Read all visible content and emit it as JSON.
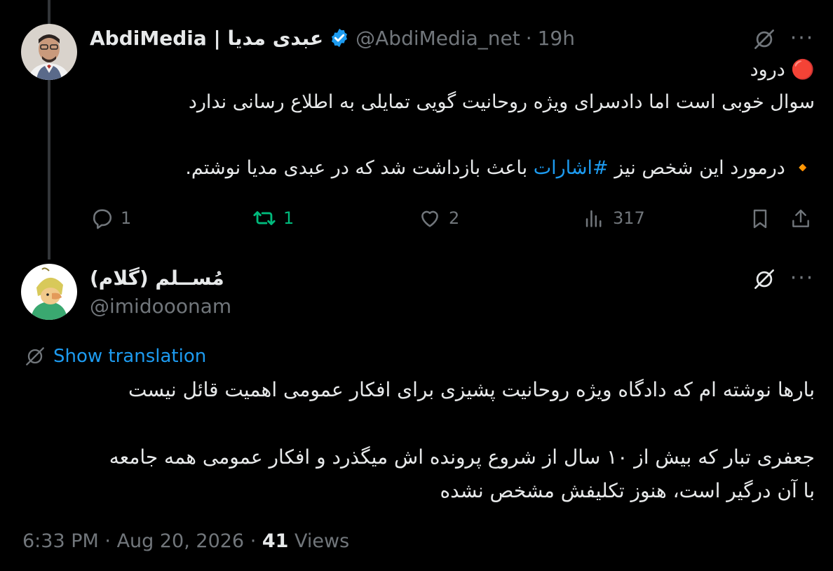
{
  "tweet1": {
    "display_name": "AbdiMedia | عبدی مدیا",
    "handle": "@AbdiMedia_net",
    "time": "19h",
    "body_line1_emoji": "🔴",
    "body_line1": "درود",
    "body_line2": "سوال خوبی است اما دادسرای ویژه روحانیت گویی تمایلی به اطلاع رسانی ندارد",
    "body_line3_emoji": "🔸",
    "body_line3_before": "درمورد این شخص نیز",
    "body_line3_hashtag": "#اشارات",
    "body_line3_after": "باعث بازداشت شد که در عبدی مدیا نوشتم.",
    "actions": {
      "replies": "1",
      "retweets": "1",
      "likes": "2",
      "views": "317"
    }
  },
  "tweet2": {
    "display_name": "مُســلم (گلام)",
    "handle": "@imidooonam",
    "show_translation": "Show translation",
    "paragraph1": "بارها نوشته ام که دادگاه ویژه روحانیت پشیزی برای افکار عمومی اهمیت قائل نیست",
    "paragraph2_line1": "جعفری تبار که بیش از ۱۰ سال از شروع پرونده اش میگذرد و افکار عمومی همه جامعه",
    "paragraph2_line2": "با آن درگیر است، هنوز تکلیفش مشخص نشده",
    "time": "6:33 PM",
    "date": "Aug 20, 2026",
    "views_count": "41",
    "views_label": "Views"
  },
  "icons": {
    "more": "more-icon",
    "grok": "grok-icon",
    "verified": "verified-badge-icon",
    "reply": "reply-icon",
    "retweet": "retweet-icon",
    "like": "heart-icon",
    "views": "views-icon",
    "bookmark": "bookmark-icon",
    "share": "share-icon"
  },
  "colors": {
    "accent": "#1d9bf0",
    "retweet_green": "#00ba7c",
    "muted": "#71767b"
  }
}
